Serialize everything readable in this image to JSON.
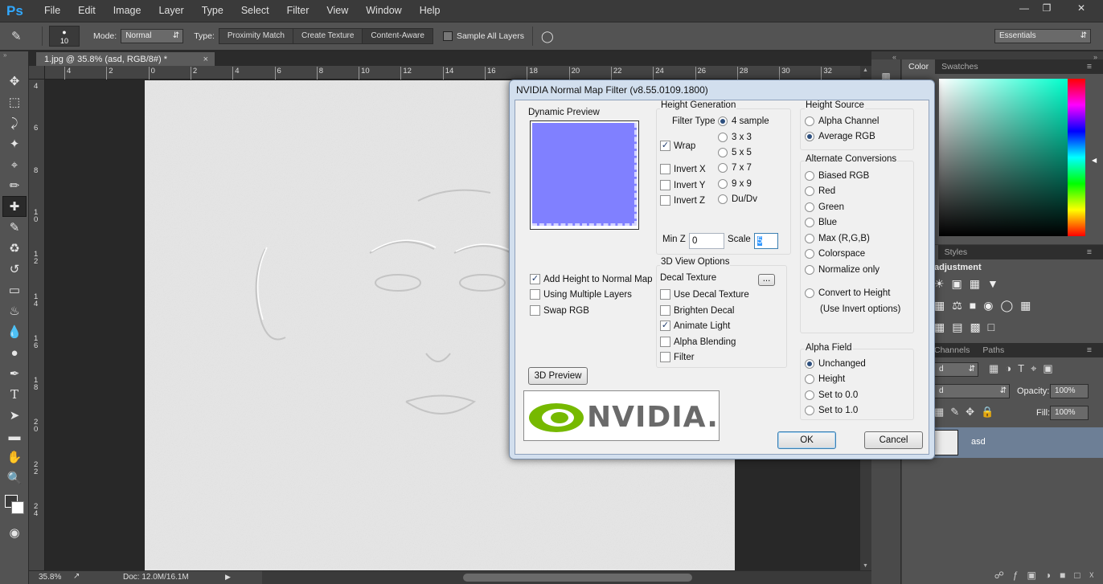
{
  "app": {
    "logo": "Ps"
  },
  "menu": [
    "File",
    "Edit",
    "Image",
    "Layer",
    "Type",
    "Select",
    "Filter",
    "View",
    "Window",
    "Help"
  ],
  "options": {
    "brush_size": "10",
    "mode_label": "Mode:",
    "mode_value": "Normal",
    "type_label": "Type:",
    "type_options": [
      "Proximity Match",
      "Create Texture",
      "Content-Aware"
    ],
    "sample_all_layers": "Sample All Layers",
    "workspace": "Essentials"
  },
  "document": {
    "tab_title": "1.jpg @ 35.8% (asd, RGB/8#) *",
    "tab_close": "×"
  },
  "ruler_h": [
    "4",
    "2",
    "0",
    "2",
    "4",
    "6",
    "8",
    "10",
    "12",
    "14",
    "16",
    "18",
    "20",
    "22",
    "24",
    "26",
    "28",
    "30",
    "32",
    "34"
  ],
  "ruler_v": [
    "4",
    "6",
    "8",
    "1 0",
    "1 2",
    "1 4",
    "1 6",
    "1 8",
    "2 0",
    "2 2",
    "2 4"
  ],
  "status": {
    "zoom": "35.8%",
    "doc": "Doc: 12.0M/16.1M"
  },
  "panels": {
    "color_tabs": [
      "Color",
      "Swatches"
    ],
    "adjust_tabs": [
      "ments",
      "Styles"
    ],
    "adjust_title": "adjustment",
    "layers_tabs": [
      "Channels",
      "Paths"
    ],
    "opacity_label": "Opacity:",
    "opacity_value": "100%",
    "fill_label": "Fill:",
    "fill_value": "100%",
    "layer_name": "asd",
    "blend_partial": "d",
    "kind_partial": "d"
  },
  "dialog": {
    "title": "NVIDIA Normal Map Filter (v8.55.0109.1800)",
    "dynamic_preview": "Dynamic Preview",
    "height_generation": "Height Generation",
    "filter_type": "Filter Type",
    "filter_options": [
      "4 sample",
      "3 x 3",
      "5 x 5",
      "7 x 7",
      "9 x 9",
      "Du/Dv"
    ],
    "wrap": "Wrap",
    "invert_x": "Invert X",
    "invert_y": "Invert Y",
    "invert_z": "Invert Z",
    "min_z_label": "Min Z",
    "min_z_value": "0",
    "scale_label": "Scale",
    "scale_value": "5",
    "height_source": "Height Source",
    "alpha_channel": "Alpha Channel",
    "average_rgb": "Average RGB",
    "alternate_conversions": "Alternate Conversions",
    "alt_options": [
      "Biased RGB",
      "Red",
      "Green",
      "Blue",
      "Max (R,G,B)",
      "Colorspace",
      "Normalize only"
    ],
    "convert_to_height": "Convert to Height",
    "use_invert_options": "(Use Invert options)",
    "add_height": "Add Height to Normal Map",
    "using_multiple_layers": "Using Multiple Layers",
    "swap_rgb": "Swap RGB",
    "view_options": "3D View Options",
    "decal_texture": "Decal Texture",
    "decal_btn": "...",
    "use_decal_texture": "Use Decal Texture",
    "brighten_decal": "Brighten Decal",
    "animate_light": "Animate Light",
    "alpha_blending": "Alpha Blending",
    "filter": "Filter",
    "preview_3d": "3D Preview",
    "alpha_field": "Alpha Field",
    "alpha_options": [
      "Unchanged",
      "Height",
      "Set to 0.0",
      "Set to 1.0"
    ],
    "ok": "OK",
    "cancel": "Cancel",
    "logo_text": "NVIDIA."
  },
  "colors": {
    "preview": "#8080ff",
    "accent": "#31a8ff",
    "nvidia_green": "#76b900"
  }
}
